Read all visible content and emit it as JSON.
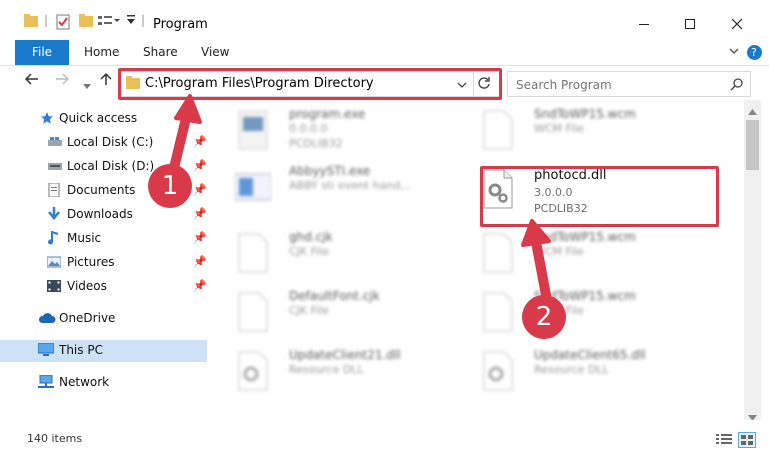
{
  "window": {
    "title": "Program"
  },
  "ribbon": {
    "tabs": [
      "File",
      "Home",
      "Share",
      "View"
    ]
  },
  "address": {
    "path": "C:\\Program Files\\Program Directory"
  },
  "search": {
    "placeholder": "Search Program"
  },
  "sidebar": {
    "items": [
      {
        "label": "Quick access",
        "icon": "star-icon"
      },
      {
        "label": "Local Disk (C:)",
        "icon": "drive-icon"
      },
      {
        "label": "Local Disk (D:)",
        "icon": "drive-icon"
      },
      {
        "label": "Documents",
        "icon": "documents-icon"
      },
      {
        "label": "Downloads",
        "icon": "download-icon"
      },
      {
        "label": "Music",
        "icon": "music-icon"
      },
      {
        "label": "Pictures",
        "icon": "pictures-icon"
      },
      {
        "label": "Videos",
        "icon": "videos-icon"
      },
      {
        "label": "OneDrive",
        "icon": "cloud-icon"
      },
      {
        "label": "This PC",
        "icon": "computer-icon"
      },
      {
        "label": "Network",
        "icon": "network-icon"
      }
    ]
  },
  "files": {
    "left": [
      {
        "name": "program.exe",
        "line2": "0.0.0.0",
        "line3": "PCDLIB32"
      },
      {
        "name": "AbbyySTI.exe",
        "line2": "ABBY sti event hand...",
        "line3": ""
      },
      {
        "name": "ghd.cjk",
        "line2": "CJK File",
        "line3": ""
      },
      {
        "name": "DefaultFont.cjk",
        "line2": "CJK File",
        "line3": ""
      },
      {
        "name": "UpdateClient21.dll",
        "line2": "Resource DLL",
        "line3": ""
      }
    ],
    "right": [
      {
        "name": "SndToWP15.wcm",
        "line2": "WCM File",
        "line3": ""
      },
      {
        "name": "photocd.dll",
        "line2": "3.0.0.0",
        "line3": "PCDLIB32"
      },
      {
        "name": "SndToWP15.wcm",
        "line2": "WCM File",
        "line3": ""
      },
      {
        "name": "SndToWP15.wcm",
        "line2": "WCM File",
        "line3": ""
      },
      {
        "name": "UpdateClient65.dll",
        "line2": "Resource DLL",
        "line3": ""
      }
    ]
  },
  "status": {
    "count": "140 items"
  },
  "markers": {
    "one": "1",
    "two": "2"
  },
  "colors": {
    "accent": "#1979ca",
    "highlight": "#d83a4a"
  }
}
